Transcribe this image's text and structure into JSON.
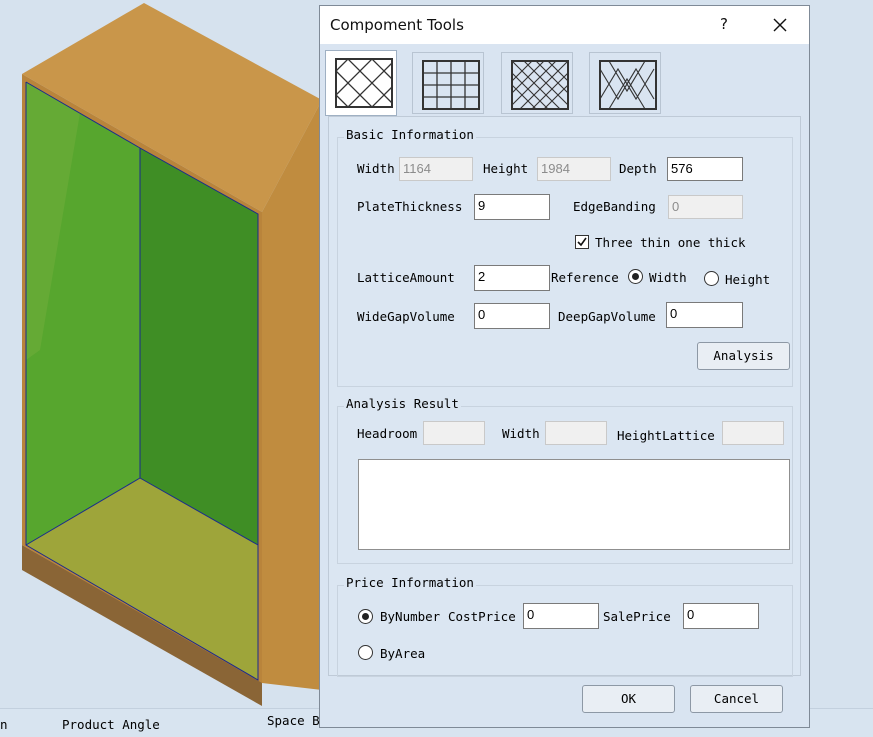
{
  "dialog": {
    "title": "Compoment Tools",
    "help": "?",
    "close": "✕"
  },
  "tabs": [
    {
      "icon": "diamond-lattice-icon",
      "selected": true
    },
    {
      "icon": "grid-lattice-icon",
      "selected": false
    },
    {
      "icon": "diamond-lattice-icon",
      "selected": false
    },
    {
      "icon": "diamond-lattice-icon",
      "selected": false
    }
  ],
  "basic": {
    "title": "Basic Information",
    "width_label": "Width",
    "width_value": "1164",
    "height_label": "Height",
    "height_value": "1984",
    "depth_label": "Depth",
    "depth_value": "576",
    "plate_label": "PlateThickness",
    "plate_value": "9",
    "edge_label": "EdgeBanding",
    "edge_value": "0",
    "three_thin_label": "Three thin one thick",
    "three_thin_checked": true,
    "lattice_label": "LatticeAmount",
    "lattice_value": "2",
    "reference_label": "Reference",
    "ref_width_label": "Width",
    "ref_height_label": "Height",
    "reference_selected": "Width",
    "wide_gap_label": "WideGapVolume",
    "wide_gap_value": "0",
    "deep_gap_label": "DeepGapVolume",
    "deep_gap_value": "0",
    "analysis_button": "Analysis"
  },
  "result": {
    "title": "Analysis Result",
    "headroom_label": "Headroom",
    "headroom_value": "",
    "width_label": "Width",
    "width_value": "",
    "height_lattice_label": "HeightLattice",
    "height_lattice_value": "",
    "output": ""
  },
  "price": {
    "title": "Price Information",
    "by_number_label": "ByNumber",
    "cost_label": "CostPrice",
    "cost_value": "0",
    "sale_label": "SalePrice",
    "sale_value": "0",
    "by_area_label": "ByArea",
    "selected": "ByNumber"
  },
  "actions": {
    "ok": "OK",
    "cancel": "Cancel"
  },
  "bottom": {
    "left_fragment": "n",
    "product_angle": "Product Angle",
    "space_fragment": "Space B"
  }
}
